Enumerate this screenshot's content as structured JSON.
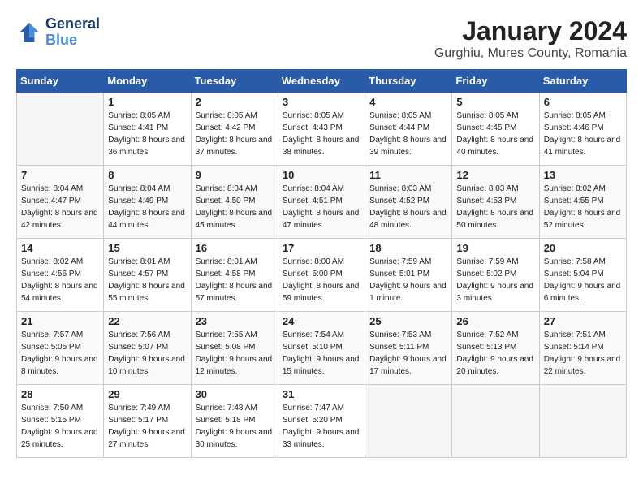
{
  "logo": {
    "line1": "General",
    "line2": "Blue"
  },
  "title": "January 2024",
  "location": "Gurghiu, Mures County, Romania",
  "weekdays": [
    "Sunday",
    "Monday",
    "Tuesday",
    "Wednesday",
    "Thursday",
    "Friday",
    "Saturday"
  ],
  "weeks": [
    [
      {
        "day": "",
        "empty": true
      },
      {
        "day": "1",
        "sunrise": "8:05 AM",
        "sunset": "4:41 PM",
        "daylight": "8 hours and 36 minutes."
      },
      {
        "day": "2",
        "sunrise": "8:05 AM",
        "sunset": "4:42 PM",
        "daylight": "8 hours and 37 minutes."
      },
      {
        "day": "3",
        "sunrise": "8:05 AM",
        "sunset": "4:43 PM",
        "daylight": "8 hours and 38 minutes."
      },
      {
        "day": "4",
        "sunrise": "8:05 AM",
        "sunset": "4:44 PM",
        "daylight": "8 hours and 39 minutes."
      },
      {
        "day": "5",
        "sunrise": "8:05 AM",
        "sunset": "4:45 PM",
        "daylight": "8 hours and 40 minutes."
      },
      {
        "day": "6",
        "sunrise": "8:05 AM",
        "sunset": "4:46 PM",
        "daylight": "8 hours and 41 minutes."
      }
    ],
    [
      {
        "day": "7",
        "sunrise": "8:04 AM",
        "sunset": "4:47 PM",
        "daylight": "8 hours and 42 minutes."
      },
      {
        "day": "8",
        "sunrise": "8:04 AM",
        "sunset": "4:49 PM",
        "daylight": "8 hours and 44 minutes."
      },
      {
        "day": "9",
        "sunrise": "8:04 AM",
        "sunset": "4:50 PM",
        "daylight": "8 hours and 45 minutes."
      },
      {
        "day": "10",
        "sunrise": "8:04 AM",
        "sunset": "4:51 PM",
        "daylight": "8 hours and 47 minutes."
      },
      {
        "day": "11",
        "sunrise": "8:03 AM",
        "sunset": "4:52 PM",
        "daylight": "8 hours and 48 minutes."
      },
      {
        "day": "12",
        "sunrise": "8:03 AM",
        "sunset": "4:53 PM",
        "daylight": "8 hours and 50 minutes."
      },
      {
        "day": "13",
        "sunrise": "8:02 AM",
        "sunset": "4:55 PM",
        "daylight": "8 hours and 52 minutes."
      }
    ],
    [
      {
        "day": "14",
        "sunrise": "8:02 AM",
        "sunset": "4:56 PM",
        "daylight": "8 hours and 54 minutes."
      },
      {
        "day": "15",
        "sunrise": "8:01 AM",
        "sunset": "4:57 PM",
        "daylight": "8 hours and 55 minutes."
      },
      {
        "day": "16",
        "sunrise": "8:01 AM",
        "sunset": "4:58 PM",
        "daylight": "8 hours and 57 minutes."
      },
      {
        "day": "17",
        "sunrise": "8:00 AM",
        "sunset": "5:00 PM",
        "daylight": "8 hours and 59 minutes."
      },
      {
        "day": "18",
        "sunrise": "7:59 AM",
        "sunset": "5:01 PM",
        "daylight": "9 hours and 1 minute."
      },
      {
        "day": "19",
        "sunrise": "7:59 AM",
        "sunset": "5:02 PM",
        "daylight": "9 hours and 3 minutes."
      },
      {
        "day": "20",
        "sunrise": "7:58 AM",
        "sunset": "5:04 PM",
        "daylight": "9 hours and 6 minutes."
      }
    ],
    [
      {
        "day": "21",
        "sunrise": "7:57 AM",
        "sunset": "5:05 PM",
        "daylight": "9 hours and 8 minutes."
      },
      {
        "day": "22",
        "sunrise": "7:56 AM",
        "sunset": "5:07 PM",
        "daylight": "9 hours and 10 minutes."
      },
      {
        "day": "23",
        "sunrise": "7:55 AM",
        "sunset": "5:08 PM",
        "daylight": "9 hours and 12 minutes."
      },
      {
        "day": "24",
        "sunrise": "7:54 AM",
        "sunset": "5:10 PM",
        "daylight": "9 hours and 15 minutes."
      },
      {
        "day": "25",
        "sunrise": "7:53 AM",
        "sunset": "5:11 PM",
        "daylight": "9 hours and 17 minutes."
      },
      {
        "day": "26",
        "sunrise": "7:52 AM",
        "sunset": "5:13 PM",
        "daylight": "9 hours and 20 minutes."
      },
      {
        "day": "27",
        "sunrise": "7:51 AM",
        "sunset": "5:14 PM",
        "daylight": "9 hours and 22 minutes."
      }
    ],
    [
      {
        "day": "28",
        "sunrise": "7:50 AM",
        "sunset": "5:15 PM",
        "daylight": "9 hours and 25 minutes."
      },
      {
        "day": "29",
        "sunrise": "7:49 AM",
        "sunset": "5:17 PM",
        "daylight": "9 hours and 27 minutes."
      },
      {
        "day": "30",
        "sunrise": "7:48 AM",
        "sunset": "5:18 PM",
        "daylight": "9 hours and 30 minutes."
      },
      {
        "day": "31",
        "sunrise": "7:47 AM",
        "sunset": "5:20 PM",
        "daylight": "9 hours and 33 minutes."
      },
      {
        "day": "",
        "empty": true
      },
      {
        "day": "",
        "empty": true
      },
      {
        "day": "",
        "empty": true
      }
    ]
  ]
}
